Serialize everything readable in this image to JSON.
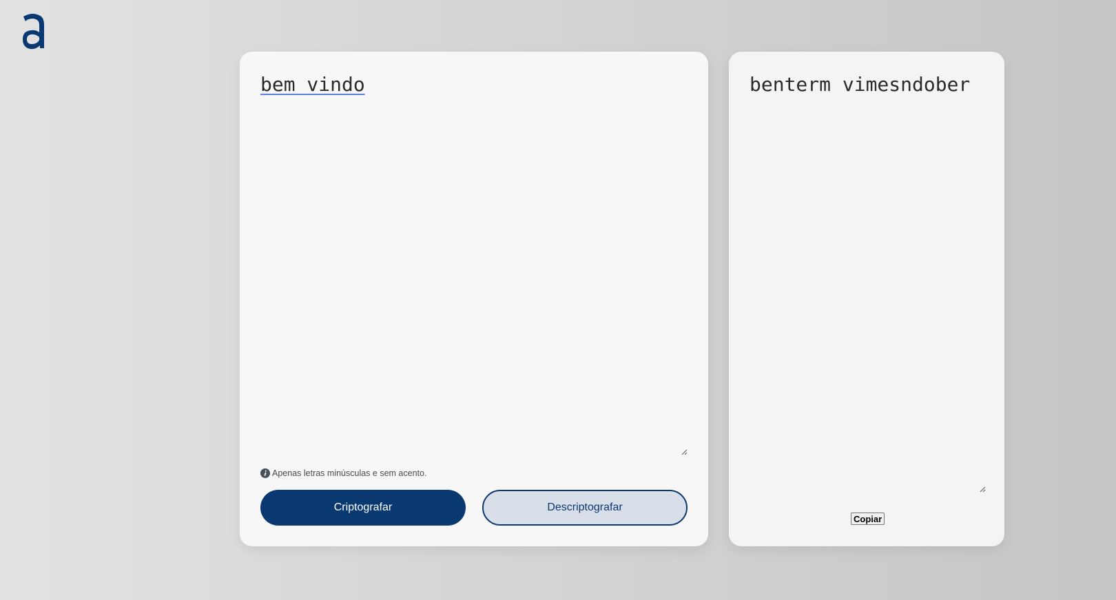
{
  "logo": {
    "icon": "alura-a-logo-icon",
    "color": "#0a3871"
  },
  "input": {
    "value": "bem vindo",
    "hint_icon": "info-icon",
    "hint_text": "Apenas letras minúsculas e sem acento."
  },
  "buttons": {
    "encrypt_label": "Criptografar",
    "decrypt_label": "Descriptografar"
  },
  "output": {
    "value": "benterm vimesndober",
    "copy_label": "Copiar"
  },
  "colors": {
    "accent": "#0a3871",
    "decrypt_bg": "#d8dfe8",
    "card_bg": "#f7f7f7"
  }
}
